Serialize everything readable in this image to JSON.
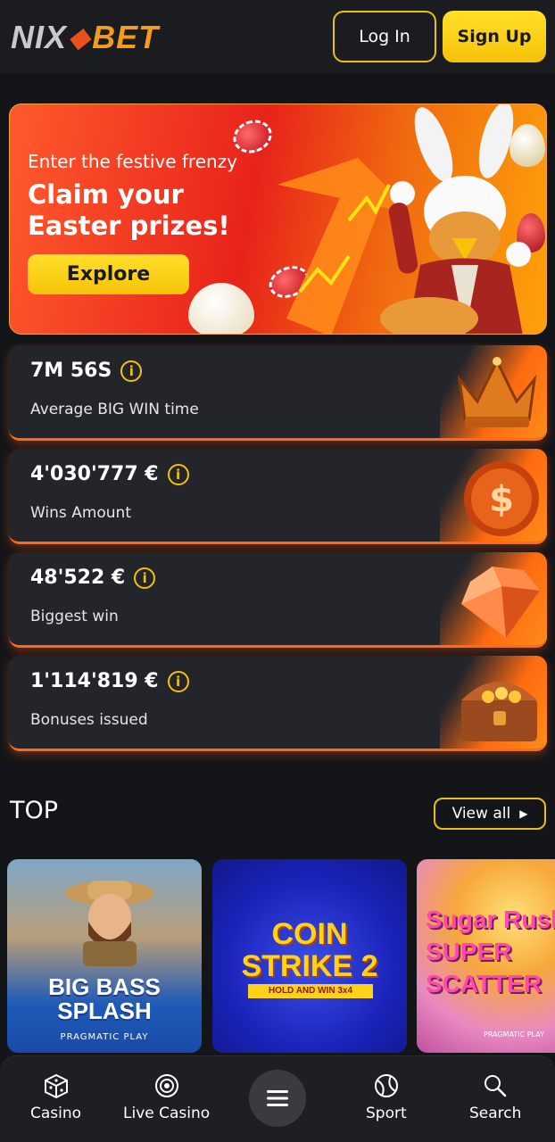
{
  "header": {
    "logo_left": "NIX",
    "logo_right": "BET",
    "login_label": "Log In",
    "signup_label": "Sign Up"
  },
  "hero": {
    "subtitle": "Enter the festive frenzy",
    "title": "Claim your Easter prizes!",
    "button_label": "Explore"
  },
  "stats": [
    {
      "value": "7M 56S",
      "label": "Average BIG WIN time",
      "icon": "crown-icon"
    },
    {
      "value": "4'030'777 €",
      "label": "Wins Amount",
      "icon": "dollar-coin-icon"
    },
    {
      "value": "48'522 €",
      "label": "Biggest win",
      "icon": "diamond-icon"
    },
    {
      "value": "1'114'819 €",
      "label": "Bonuses issued",
      "icon": "treasure-chest-icon"
    }
  ],
  "top": {
    "title": "TOP",
    "view_all_label": "View all",
    "games": [
      {
        "title": "BIG BASS SPLASH",
        "provider": "PRAGMATIC PLAY"
      },
      {
        "title": "COIN STRIKE 2",
        "subtitle": "HOLD AND WIN 3x4"
      },
      {
        "title": "Sugar Rush SUPER SCATTER",
        "provider": "PRAGMATIC PLAY"
      }
    ]
  },
  "bottom_nav": {
    "items": [
      {
        "label": "Casino",
        "icon": "dice-icon"
      },
      {
        "label": "Live Casino",
        "icon": "live-target-icon"
      },
      {
        "label": "",
        "icon": "menu-icon"
      },
      {
        "label": "Sport",
        "icon": "tennis-ball-icon"
      },
      {
        "label": "Search",
        "icon": "search-icon"
      }
    ]
  },
  "colors": {
    "accent_yellow": "#f7c20a",
    "accent_orange": "#ff6a1a",
    "background": "#141518",
    "card": "#24252b"
  }
}
